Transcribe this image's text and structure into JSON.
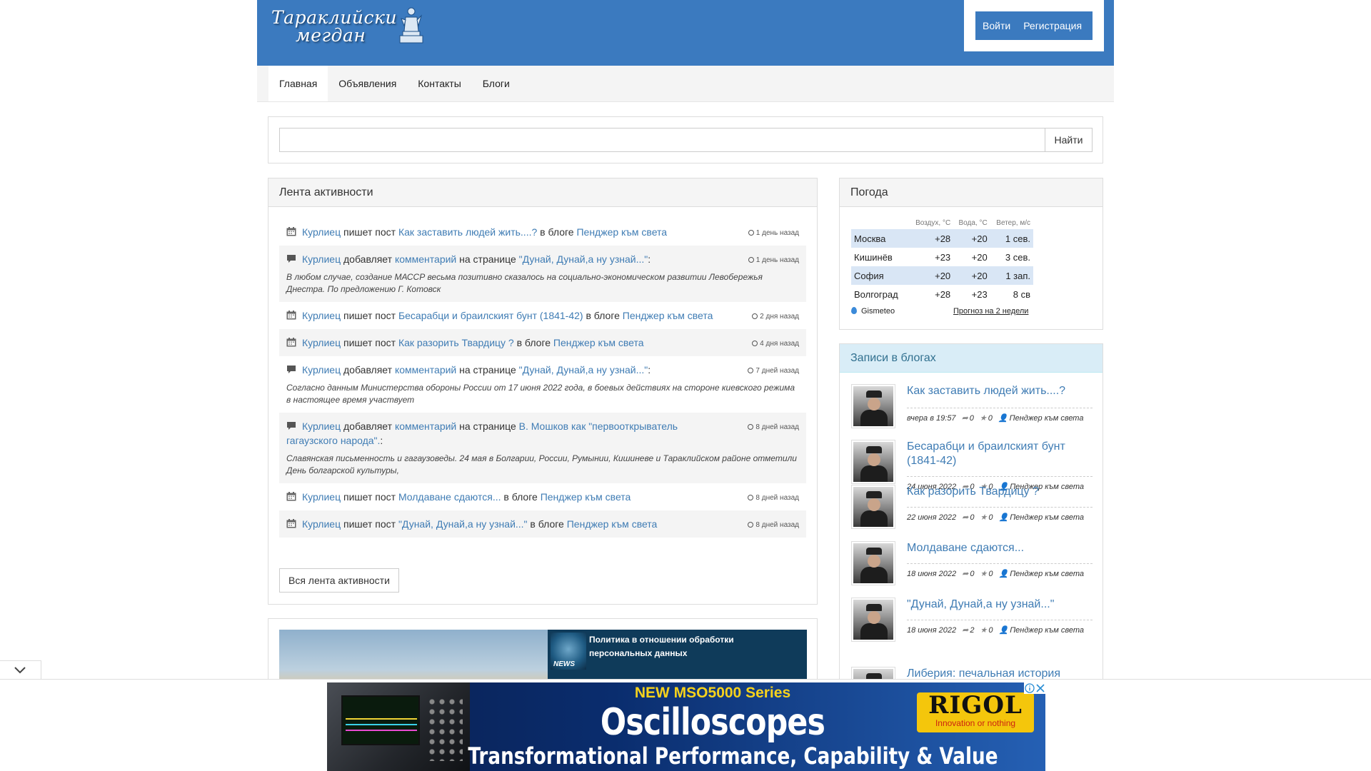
{
  "header": {
    "logo": {
      "line1": "Тараклийски",
      "line2": "мегдан"
    },
    "login_label": "Войти",
    "register_label": "Регистрация"
  },
  "nav": {
    "items": [
      "Главная",
      "Объявления",
      "Контакты",
      "Блоги"
    ],
    "active": "Главная"
  },
  "search": {
    "value": "",
    "button_label": "Найти"
  },
  "activity": {
    "title": "Лента активности",
    "items": [
      {
        "type": "post",
        "user": "Курлиец",
        "action": "пишет пост",
        "target": "Как заставить людей жить....?",
        "mid": "в блоге",
        "place": "Пенджер към света",
        "time": "1 день назад"
      },
      {
        "type": "comment",
        "user": "Курлиец",
        "action": "добавляет",
        "target": "комментарий",
        "mid": "на странице",
        "place": "\"Дунай, Дунай,а ну узнай...\"",
        "suffix": ":",
        "time": "1 день назад",
        "quote": "В любом случае, создание МАССР весьма позитивно сказалось на социально-экономическом развитии Левобережья Днестра. По предложению Г. Котовск"
      },
      {
        "type": "post",
        "user": "Курлиец",
        "action": "пишет пост",
        "target": "Бесарабци и браилският бунт (1841-42)",
        "mid": "в блоге",
        "place": "Пенджер към света",
        "time": "2 дня назад"
      },
      {
        "type": "post",
        "user": "Курлиец",
        "action": "пишет пост",
        "target": "Как разорить Твардицу ?",
        "mid": "в блоге",
        "place": "Пенджер към света",
        "time": "4 дня назад"
      },
      {
        "type": "comment",
        "user": "Курлиец",
        "action": "добавляет",
        "target": "комментарий",
        "mid": "на странице",
        "place": "\"Дунай, Дунай,а ну узнай...\"",
        "suffix": ":",
        "time": "7 дней назад",
        "quote": "Согласно данным Министерства обороны России от 17 июня 2022 года, в боевых действиях на стороне киевского режима в настоящее время участвует"
      },
      {
        "type": "comment",
        "user": "Курлиец",
        "action": "добавляет",
        "target": "комментарий",
        "mid": "на странице",
        "place": "В. Мошков как \"первооткрыватель гагаузского народа\".",
        "suffix": ":",
        "time": "8 дней назад",
        "quote": "Славянская письменность и гагаузоведы. 24 мая в Болгарии, России, Румынии, Кишиневе и Тараклийском районе отметили День болгарской культуры,"
      },
      {
        "type": "post",
        "user": "Курлиец",
        "action": "пишет пост",
        "target": "Молдаване сдаются...",
        "mid": "в блоге",
        "place": "Пенджер към света",
        "time": "8 дней назад"
      },
      {
        "type": "post",
        "user": "Курлиец",
        "action": "пишет пост",
        "target": "\"Дунай, Дунай,а ну узнай...\"",
        "mid": "в блоге",
        "place": "Пенджер към света",
        "time": "8 дней назад"
      }
    ],
    "all_button": "Вся лента активности"
  },
  "weather": {
    "title": "Погода",
    "columns": [
      "Воздух, °C",
      "Вода, °C",
      "Ветер, м/с"
    ],
    "rows": [
      {
        "city": "Москва",
        "air": "+28",
        "water": "+20",
        "wind": "1 сев."
      },
      {
        "city": "Кишинёв",
        "air": "+23",
        "water": "+20",
        "wind": "3 сев."
      },
      {
        "city": "София",
        "air": "+20",
        "water": "+20",
        "wind": "1 зап."
      },
      {
        "city": "Волгоград",
        "air": "+28",
        "water": "+23",
        "wind": "8 св"
      }
    ],
    "source": "Gismeteo",
    "forecast_link": "Прогноз на 2 недели"
  },
  "blogs": {
    "title": "Записи в блогах",
    "entries": [
      {
        "title": "Как заставить людей жить....?",
        "date": "вчера в 19:57",
        "reposts": "0",
        "rating": "0",
        "blog": "Пенджер към света"
      },
      {
        "title": "Бесарабци и браилският бунт (1841-42)",
        "date": "24 июня 2022",
        "reposts": "0",
        "rating": "0",
        "blog": "Пенджер към света"
      },
      {
        "title": "Как разорить Твардицу ?",
        "date": "22 июня 2022",
        "reposts": "0",
        "rating": "0",
        "blog": "Пенджер към света"
      },
      {
        "title": "Молдаване сдаются...",
        "date": "18 июня 2022",
        "reposts": "0",
        "rating": "0",
        "blog": "Пенджер към света"
      },
      {
        "title": "\"Дунай, Дунай,а ну узнай...\"",
        "date": "18 июня 2022",
        "reposts": "2",
        "rating": "0",
        "blog": "Пенджер към света"
      },
      {
        "title": "Либерия: печальная история",
        "date": "",
        "reposts": "",
        "rating": "",
        "blog": ""
      }
    ]
  },
  "media": {
    "news_label": "NEWS",
    "news_title": "Политика в отношении обработки персональных данных"
  },
  "ad": {
    "headline": "NEW MSO5000 Series",
    "title": "Oscilloscopes",
    "subtitle": "Transformational Performance, Capability & Value",
    "brand": "RIGOL",
    "brand_tagline": "Innovation or nothing"
  },
  "colors": {
    "header_blue": "#3b7abf",
    "link_blue": "#3f7cb4",
    "weather_highlight": "#d9e6f5",
    "blogs_head": "#d9edf7",
    "ad_yellow": "#f6d21c"
  }
}
